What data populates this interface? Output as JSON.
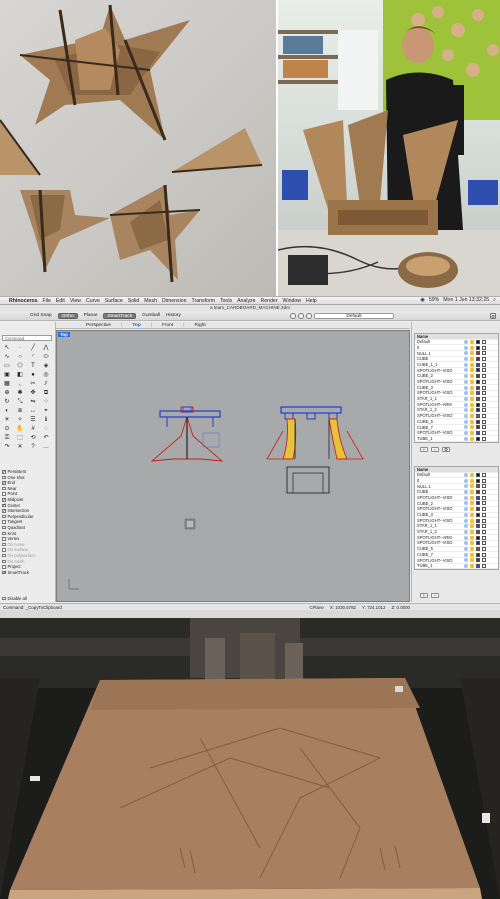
{
  "menubar": {
    "apple": "",
    "app": "Rhinoceros",
    "items": [
      "File",
      "Edit",
      "View",
      "Curve",
      "Surface",
      "Solid",
      "Mesh",
      "Dimension",
      "Transform",
      "Tools",
      "Analyze",
      "Render",
      "Window",
      "Help"
    ],
    "battery": "59%",
    "clock": "Mon 1 Jun 13:32:25"
  },
  "window": {
    "title": "a team_CARDBOARD_MACHINE.3dm"
  },
  "toolbar": {
    "items": [
      "Grid Snap",
      "Ortho",
      "Planar",
      "SmartTrack",
      "Gumball",
      "History"
    ],
    "active_items": [
      "Ortho",
      "SmartTrack"
    ],
    "layer_select": "Default"
  },
  "viewtabs": {
    "items": [
      "Perspective",
      "Top",
      "Front",
      "Right"
    ],
    "active": "Top"
  },
  "left_panel": {
    "command_placeholder": "Command",
    "snaps": [
      {
        "label": "Persistent",
        "on": true,
        "dim": false
      },
      {
        "label": "One shot",
        "on": false,
        "dim": false
      },
      {
        "label": "End",
        "on": true,
        "dim": false
      },
      {
        "label": "Near",
        "on": false,
        "dim": false
      },
      {
        "label": "Point",
        "on": false,
        "dim": false
      },
      {
        "label": "Midpoint",
        "on": true,
        "dim": false
      },
      {
        "label": "Center",
        "on": true,
        "dim": false
      },
      {
        "label": "Intersection",
        "on": true,
        "dim": false
      },
      {
        "label": "Perpendicular",
        "on": false,
        "dim": false
      },
      {
        "label": "Tangent",
        "on": false,
        "dim": false
      },
      {
        "label": "Quadrant",
        "on": false,
        "dim": false
      },
      {
        "label": "Knot",
        "on": false,
        "dim": false
      },
      {
        "label": "Vertex",
        "on": false,
        "dim": false
      },
      {
        "label": "On curve",
        "on": false,
        "dim": true
      },
      {
        "label": "On surface",
        "on": false,
        "dim": true
      },
      {
        "label": "On polysurface",
        "on": false,
        "dim": true
      },
      {
        "label": "On mesh",
        "on": false,
        "dim": true
      },
      {
        "label": "Project",
        "on": false,
        "dim": false
      },
      {
        "label": "SmartTrack",
        "on": true,
        "dim": false
      }
    ],
    "disable_all": "Disable all"
  },
  "viewport": {
    "label": "Top"
  },
  "layers": {
    "header": "Name",
    "list1": [
      "Default",
      "0",
      "NULL 1",
      "CUBE",
      "CUBE_1_1",
      "SPOTLIGHT--VISO",
      "CUBE_2",
      "SPOTLIGHT--VISO",
      "CUBE_3",
      "SPOTLIGHT--VISO",
      "STAR_1_1",
      "SPOTLIGHT--ARM",
      "STAR_1_2",
      "SPOTLIGHT--VISO",
      "CUBE_5",
      "CUBE_7",
      "SPOTLIGHT--VISO",
      "TUBE_1"
    ],
    "list2": [
      "Default",
      "0",
      "NULL 1",
      "CUBE",
      "SPOTLIGHT--VISO",
      "CUBE_2",
      "SPOTLIGHT--VISO",
      "CUBE_3",
      "SPOTLIGHT--VISO",
      "STAR_1_1",
      "STAR_1_2",
      "SPOTLIGHT--ARM",
      "SPOTLIGHT--VISO",
      "CUBE_5",
      "CUBE_7",
      "SPOTLIGHT--VISO",
      "TUBE_1"
    ],
    "colors1": [
      "#111111",
      "#111111",
      "#d92020",
      "#7a1b1b",
      "#3a3ad6",
      "#1b1b6e",
      "#6b2424",
      "#1a1a1a",
      "#8a2a2a",
      "#3a3ad6",
      "#aa3030",
      "#111111",
      "#1b1b6e",
      "#b04040",
      "#2a2a2a",
      "#6b2424",
      "#3a3ad6",
      "#111111"
    ],
    "colors2": [
      "#111111",
      "#111111",
      "#d92020",
      "#7a1b1b",
      "#3a3ad6",
      "#1b1b6e",
      "#6b2424",
      "#1a1a1a",
      "#8a2a2a",
      "#3a3ad6",
      "#aa3030",
      "#111111",
      "#1b1b6e",
      "#b04040",
      "#2a2a2a",
      "#6b2424",
      "#3a3ad6"
    ]
  },
  "statusbar": {
    "command": "Command: _CopyToClipboard",
    "cplane": "CPlane",
    "x": "X: 1030.6782",
    "y": "Y: 724.1012",
    "z": "Z: 0.0000"
  }
}
